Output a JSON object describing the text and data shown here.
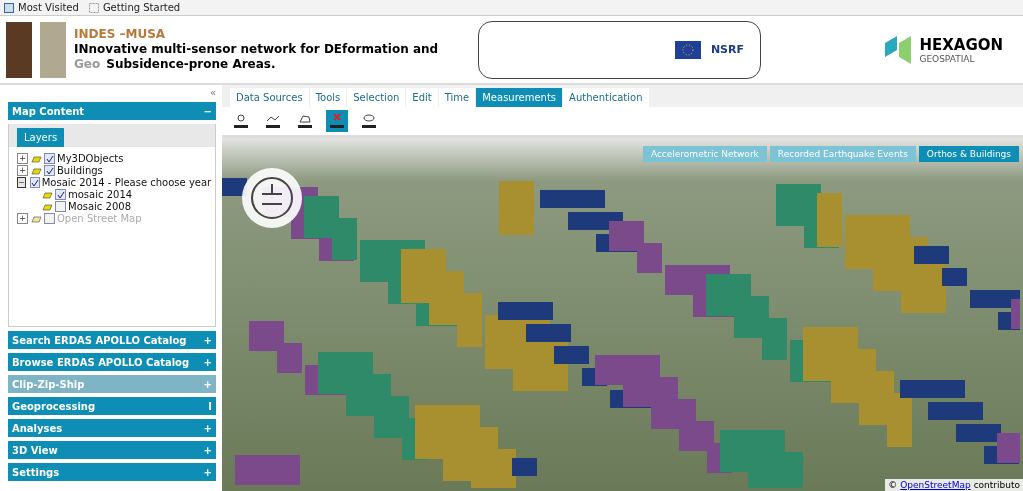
{
  "bookmarks": [
    {
      "label": "Most Visited"
    },
    {
      "label": "Getting Started"
    }
  ],
  "header": {
    "project": "INDES –MUSA",
    "line_1": "**IN**novative multi-sensor network for **DE**formation and",
    "line_2": "Subsidence-prone Areas.",
    "overlay_text": "Geo",
    "badge": "NSRF",
    "company": "HEXAGON",
    "company_sub": "GEOSPATIAL"
  },
  "sidebar": {
    "collapse_symbol": "«",
    "map_content": {
      "title": "Map Content",
      "symbol": "−",
      "tab": "Layers",
      "layers": [
        {
          "name": "My3DObjects",
          "toggle": "+",
          "checked": true,
          "disabled": false,
          "expanded": false
        },
        {
          "name": "Buildings",
          "toggle": "+",
          "checked": true,
          "disabled": false,
          "expanded": false
        },
        {
          "name": "Mosaic 2014 - Please choose year",
          "toggle": "−",
          "checked": true,
          "disabled": false,
          "expanded": true,
          "children": [
            {
              "name": "mosaic 2014",
              "checked": true,
              "disabled": false
            },
            {
              "name": "Mosaic 2008",
              "checked": false,
              "disabled": false
            }
          ]
        },
        {
          "name": "Open Street Map",
          "toggle": "+",
          "checked": false,
          "disabled": true,
          "expanded": false
        }
      ]
    },
    "panels": [
      {
        "title": "Search ERDAS APOLLO Catalog",
        "symbol": "+",
        "disabled": false
      },
      {
        "title": "Browse ERDAS APOLLO Catalog",
        "symbol": "+",
        "disabled": false
      },
      {
        "title": "Clip-Zip-Ship",
        "symbol": "+",
        "disabled": true
      },
      {
        "title": "Geoprocessing",
        "symbol": "I",
        "disabled": false
      },
      {
        "title": "Analyses",
        "symbol": "+",
        "disabled": false
      },
      {
        "title": "3D View",
        "symbol": "+",
        "disabled": false
      },
      {
        "title": "Settings",
        "symbol": "+",
        "disabled": false
      }
    ]
  },
  "tabs": [
    {
      "label": "Data Sources",
      "selected": false
    },
    {
      "label": "Tools",
      "selected": false
    },
    {
      "label": "Selection",
      "selected": false
    },
    {
      "label": "Edit",
      "selected": false
    },
    {
      "label": "Time",
      "selected": false
    },
    {
      "label": "Measurements",
      "selected": true
    },
    {
      "label": "Authentication",
      "selected": false
    }
  ],
  "tools": [
    {
      "kind": "point",
      "selected": false
    },
    {
      "kind": "line",
      "selected": false
    },
    {
      "kind": "area",
      "selected": false
    },
    {
      "kind": "clear",
      "selected": true
    },
    {
      "kind": "view",
      "selected": false
    }
  ],
  "map": {
    "layer_tabs": [
      {
        "label": "Accelerometric Network",
        "selected": false
      },
      {
        "label": "Recorded Earthquake Events",
        "selected": false
      },
      {
        "label": "Orthos & Buildings",
        "selected": true
      }
    ],
    "attribution_prefix": "©",
    "attribution_link": "OpenStreetMap",
    "attribution_rest": "contributo"
  }
}
